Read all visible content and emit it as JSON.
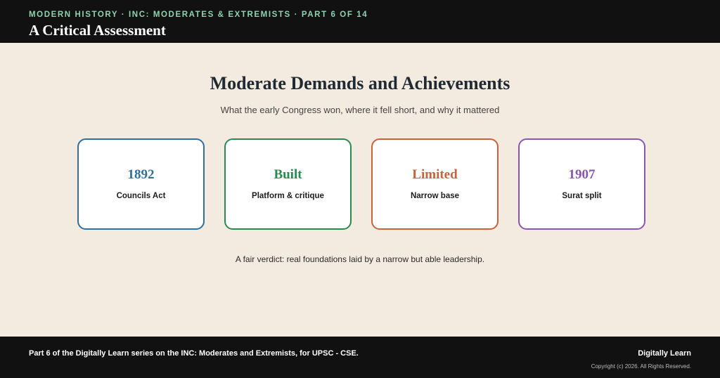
{
  "header": {
    "breadcrumb": "MODERN HISTORY · INC: MODERATES & EXTREMISTS · PART 6 OF 14",
    "title": "A Critical Assessment"
  },
  "main": {
    "heading": "Moderate Demands and Achievements",
    "subheading": "What the early Congress won, where it fell short, and why it mattered",
    "cards": [
      {
        "value": "1892",
        "label": "Councils Act",
        "color": "#2e6f9e"
      },
      {
        "value": "Built",
        "label": "Platform & critique",
        "color": "#2a8a4e"
      },
      {
        "value": "Limited",
        "label": "Narrow base",
        "color": "#c8623e"
      },
      {
        "value": "1907",
        "label": "Surat split",
        "color": "#8a55b0"
      }
    ],
    "verdict": "A fair verdict: real foundations laid by a narrow but able leadership."
  },
  "footer": {
    "description": "Part 6 of the Digitally Learn series on the INC: Moderates and Extremists, for UPSC - CSE.",
    "brand": "Digitally Learn",
    "copyright": "Copyright (c) 2026. All Rights Reserved."
  },
  "colors": {
    "background": "#f4ebe0",
    "bar": "#111111",
    "breadcrumb": "#8fd3b0"
  }
}
